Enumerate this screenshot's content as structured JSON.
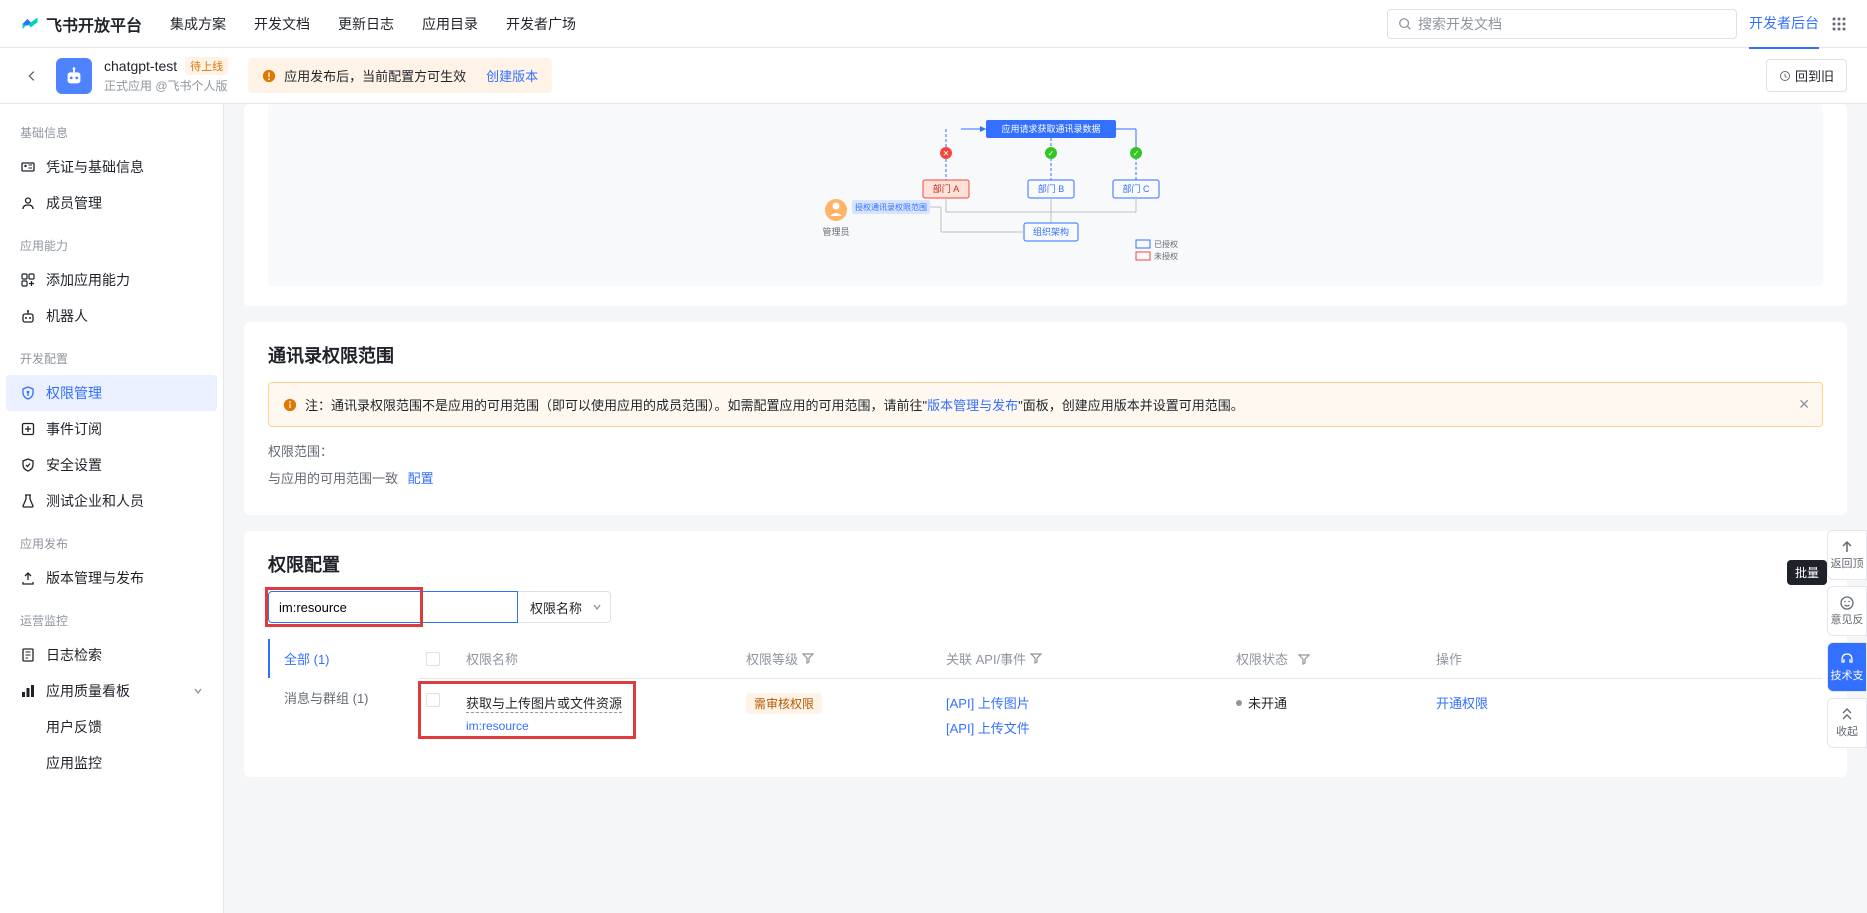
{
  "header": {
    "logo_text": "飞书开放平台",
    "nav": [
      "集成方案",
      "开发文档",
      "更新日志",
      "应用目录",
      "开发者广场"
    ],
    "search_placeholder": "搜索开发文档",
    "dev_console": "开发者后台"
  },
  "app_header": {
    "app_name": "chatgpt-test",
    "badge": "待上线",
    "subtitle": "正式应用 @飞书个人版",
    "notice_text": "应用发布后，当前配置方可生效",
    "notice_link": "创建版本",
    "back_old": "回到旧"
  },
  "sidebar": {
    "sections": [
      {
        "title": "基础信息",
        "items": [
          {
            "label": "凭证与基础信息",
            "icon": "id-card"
          },
          {
            "label": "成员管理",
            "icon": "user"
          }
        ]
      },
      {
        "title": "应用能力",
        "items": [
          {
            "label": "添加应用能力",
            "icon": "plus-grid"
          },
          {
            "label": "机器人",
            "icon": "robot"
          }
        ]
      },
      {
        "title": "开发配置",
        "items": [
          {
            "label": "权限管理",
            "icon": "shield-key",
            "active": true
          },
          {
            "label": "事件订阅",
            "icon": "plus-box"
          },
          {
            "label": "安全设置",
            "icon": "shield"
          },
          {
            "label": "测试企业和人员",
            "icon": "flask"
          }
        ]
      },
      {
        "title": "应用发布",
        "items": [
          {
            "label": "版本管理与发布",
            "icon": "upload"
          }
        ]
      },
      {
        "title": "运营监控",
        "items": [
          {
            "label": "日志检索",
            "icon": "log"
          },
          {
            "label": "应用质量看板",
            "icon": "bar-chart",
            "expand": true
          },
          {
            "label": "用户反馈",
            "no_icon": true
          },
          {
            "label": "应用监控",
            "no_icon": true
          }
        ]
      }
    ]
  },
  "diagram": {
    "top_label": "应用请求获取通讯录数据",
    "admin": "管理员",
    "auth_range": "授权通讯录权限范围",
    "dept_a": "部门 A",
    "dept_b": "部门 B",
    "dept_c": "部门 C",
    "org": "组织架构",
    "authorized": "已授权",
    "unauthorized": "未授权"
  },
  "scope_card": {
    "title": "通讯录权限范围",
    "banner_prefix": "注：通讯录权限范围不是应用的可用范围（即可以使用应用的成员范围）。如需配置应用的可用范围，请前往\"",
    "banner_link": "版本管理与发布",
    "banner_suffix": "\"面板，创建应用版本并设置可用范围。",
    "scope_label": "权限范围：",
    "scope_value": "与应用的可用范围一致",
    "scope_link": "配置"
  },
  "perm_card": {
    "title": "权限配置",
    "search_value": "im:resource",
    "type_label": "权限名称",
    "tabs": [
      {
        "label": "全部 (1)",
        "active": true
      },
      {
        "label": "消息与群组 (1)"
      }
    ],
    "columns": {
      "name": "权限名称",
      "level": "权限等级",
      "api": "关联 API/事件",
      "status": "权限状态",
      "action": "操作"
    },
    "rows": [
      {
        "name": "获取与上传图片或文件资源",
        "code": "im:resource",
        "level": "需审核权限",
        "apis": [
          "[API] 上传图片",
          "[API] 上传文件"
        ],
        "status": "未开通",
        "action": "开通权限"
      }
    ]
  },
  "float": {
    "batch": "批量",
    "back_top": "返回顶",
    "feedback": "意见反",
    "tech": "技术支",
    "collapse": "收起"
  }
}
